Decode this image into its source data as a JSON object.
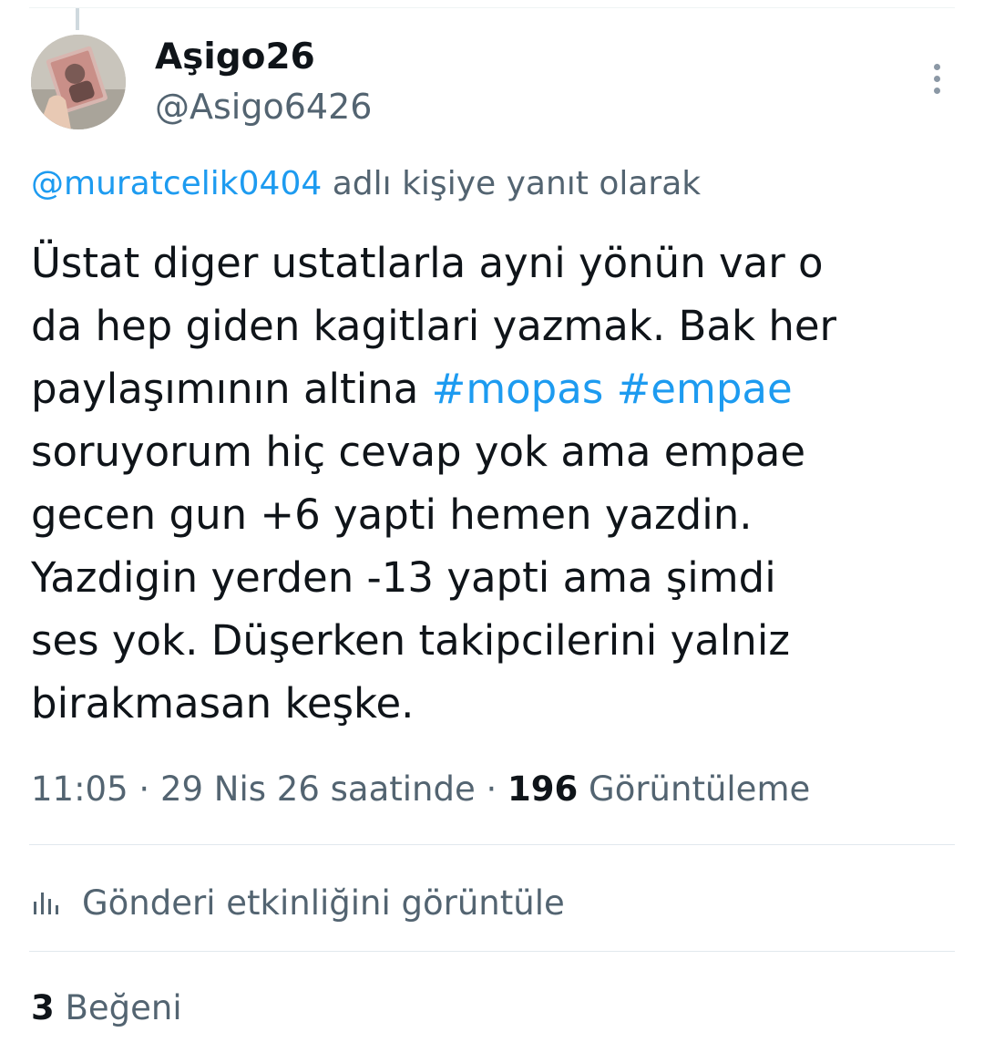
{
  "author": {
    "display_name": "Aşigo26",
    "handle": "@Asigo6426"
  },
  "reply_context": {
    "mention": "@muratcelik0404",
    "suffix": " adlı kişiye yanıt olarak"
  },
  "tweet": {
    "line1": "Üstat diger ustatlarla ayni yönün var o",
    "line2": "da hep giden kagitlari yazmak. Bak her",
    "line3_prefix": "paylaşımının altina ",
    "hashtag1": "#mopas",
    "line3_space": " ",
    "hashtag2": "#empae",
    "line4": "soruyorum hiç cevap yok ama empae",
    "line5": "gecen gun +6 yapti hemen yazdin.",
    "line6": "Yazdigin yerden -13 yapti ama şimdi",
    "line7": "ses yok. Düşerken takipcilerini yalniz",
    "line8": "birakmasan keşke."
  },
  "meta": {
    "time": "11:05",
    "sep1": " · ",
    "date": "29 Nis 26 saatinde",
    "sep2": " · ",
    "views_count": "196",
    "views_label": " Görüntüleme"
  },
  "activity": {
    "icon": "bar-chart-icon",
    "label": "Gönderi etkinliğini görüntüle"
  },
  "likes": {
    "count": "3",
    "label": " Beğeni"
  },
  "colors": {
    "link": "#1d9bf0",
    "secondary_text": "#536471",
    "primary_text": "#0f1419",
    "divider": "#e1e8ed"
  }
}
